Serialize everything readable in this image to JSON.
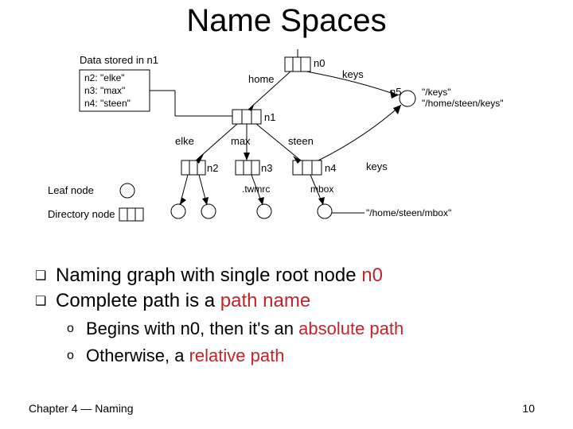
{
  "title": "Name Spaces",
  "figure": {
    "stored_header": "Data stored in n1",
    "stored_lines": [
      "n2: \"elke\"",
      "n3: \"max\"",
      "n4: \"steen\""
    ],
    "leaf_label": "Leaf node",
    "dir_label": "Directory node",
    "nodes": {
      "n0": "n0",
      "n1": "n1",
      "n2": "n2",
      "n3": "n3",
      "n4": "n4",
      "n5": "n5"
    },
    "edges": {
      "home": "home",
      "keys": "keys",
      "elke": "elke",
      "max": "max",
      "steen": "steen",
      "twmrc": ".twmrc",
      "mbox": "mbox",
      "keys2": "keys"
    },
    "n5_paths": [
      "\"/keys\"",
      "\"/home/steen/keys\""
    ],
    "mbox_path": "\"/home/steen/mbox\""
  },
  "bullets": {
    "b1_pre": "Naming graph with single root node ",
    "b1_red": "n0",
    "b2_pre": "Complete path is a ",
    "b2_red": "path name",
    "s1_pre": "Begins with n0, then it's an ",
    "s1_red": "absolute path",
    "s2_pre": "Otherwise, a ",
    "s2_red": "relative path"
  },
  "footer": {
    "left_a": "Chapter 4 ",
    "left_b": " Naming",
    "right": "10"
  },
  "marks": {
    "square": "❑",
    "circle": "o",
    "dash": "—"
  }
}
